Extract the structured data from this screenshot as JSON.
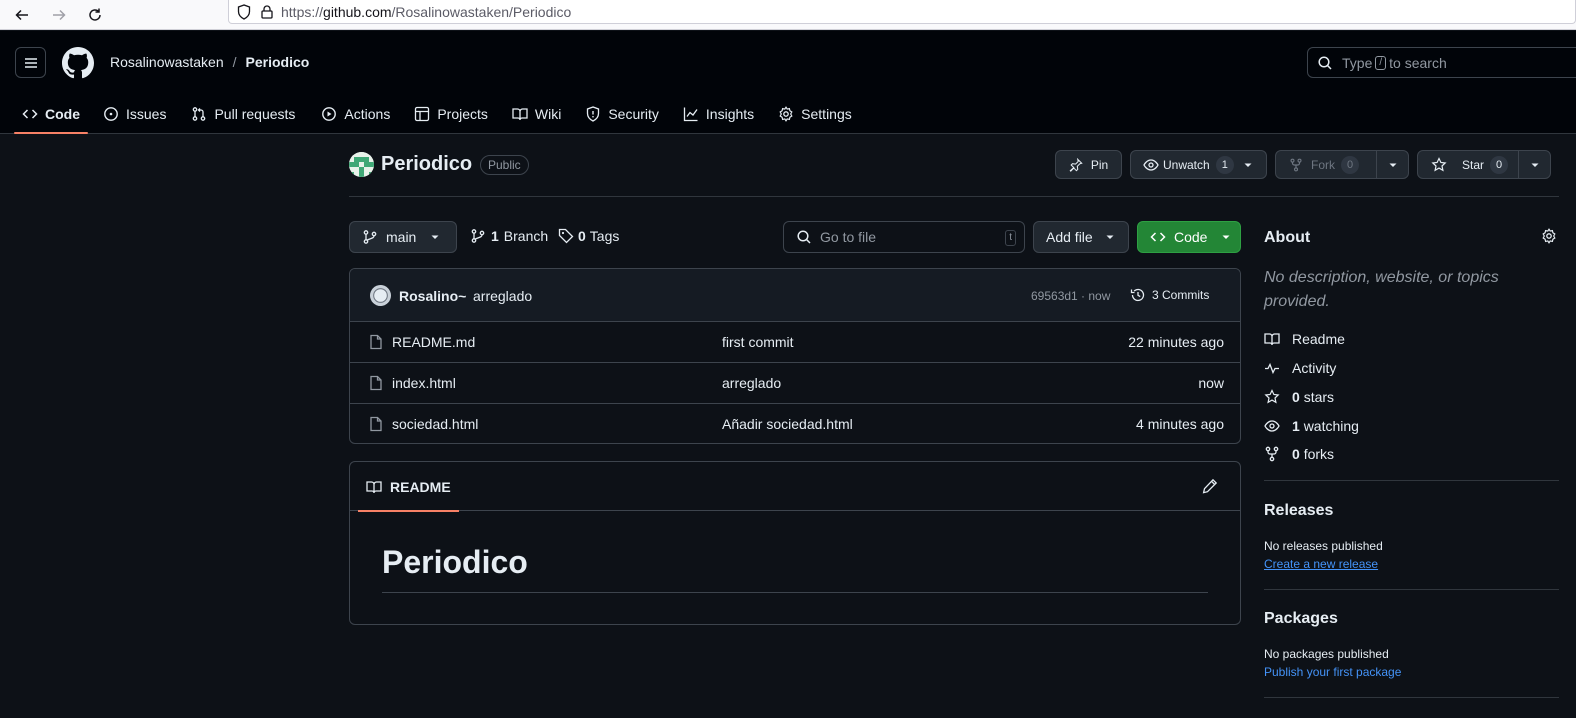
{
  "browser": {
    "url_prefix": "https://",
    "url_host": "github.com",
    "url_path": "/Rosalinowastaken/Periodico"
  },
  "header": {
    "owner": "Rosalinowastaken",
    "separator": "/",
    "repo": "Periodico",
    "search_placeholder_before": "Type",
    "search_key": "/",
    "search_placeholder_after": "to search"
  },
  "tabs": [
    {
      "label": "Code",
      "icon": "code-icon"
    },
    {
      "label": "Issues",
      "icon": "issue-icon"
    },
    {
      "label": "Pull requests",
      "icon": "pull-request-icon"
    },
    {
      "label": "Actions",
      "icon": "play-icon"
    },
    {
      "label": "Projects",
      "icon": "table-icon"
    },
    {
      "label": "Wiki",
      "icon": "book-icon"
    },
    {
      "label": "Security",
      "icon": "shield-icon"
    },
    {
      "label": "Insights",
      "icon": "graph-icon"
    },
    {
      "label": "Settings",
      "icon": "gear-icon"
    }
  ],
  "repo_header": {
    "title": "Periodico",
    "visibility": "Public",
    "pin_label": "Pin",
    "unwatch_label": "Unwatch",
    "watch_count": "1",
    "fork_label": "Fork",
    "fork_count": "0",
    "star_label": "Star",
    "star_count": "0"
  },
  "toolbar": {
    "branch": "main",
    "branches_count": "1",
    "branches_label": "Branch",
    "tags_count": "0",
    "tags_label": "Tags",
    "goto_placeholder": "Go to file",
    "goto_key": "t",
    "add_file_label": "Add file",
    "code_label": "Code"
  },
  "commit": {
    "author": "Rosalino~",
    "message": "arreglado",
    "hash_time": "69563d1 · now",
    "commits_label": "3 Commits"
  },
  "files": [
    {
      "name": "README.md",
      "message": "first commit",
      "time": "22 minutes ago"
    },
    {
      "name": "index.html",
      "message": "arreglado",
      "time": "now"
    },
    {
      "name": "sociedad.html",
      "message": "Añadir sociedad.html",
      "time": "4 minutes ago"
    }
  ],
  "readme": {
    "tab_label": "README",
    "heading": "Periodico"
  },
  "about": {
    "title": "About",
    "description": "No description, website, or topics provided.",
    "readme": "Readme",
    "activity": "Activity",
    "stars_count": "0",
    "stars_label": "stars",
    "watching_count": "1",
    "watching_label": "watching",
    "forks_count": "0",
    "forks_label": "forks"
  },
  "releases": {
    "title": "Releases",
    "note": "No releases published",
    "link": "Create a new release"
  },
  "packages": {
    "title": "Packages",
    "note": "No packages published",
    "link": "Publish your first package"
  },
  "colors": {
    "background": "#0d1117",
    "header": "#010409",
    "accent_underline": "#f78166",
    "code_button": "#238636",
    "link": "#4493f8"
  }
}
